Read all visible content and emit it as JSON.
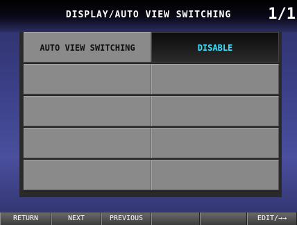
{
  "header": {
    "title": "DISPLAY/AUTO VIEW SWITCHING",
    "page_indicator": "1/1"
  },
  "rows": [
    {
      "label": "AUTO VIEW SWITCHING",
      "value": "DISABLE"
    },
    {
      "label": "",
      "value": ""
    },
    {
      "label": "",
      "value": ""
    },
    {
      "label": "",
      "value": ""
    },
    {
      "label": "",
      "value": ""
    }
  ],
  "function_keys": {
    "return": "RETURN",
    "next": "NEXT",
    "previous": "PREVIOUS",
    "blank1": "",
    "blank2": "",
    "edit": "EDIT/→→"
  },
  "colors": {
    "value_text": "#3ee0ff",
    "label_text": "#111111"
  }
}
